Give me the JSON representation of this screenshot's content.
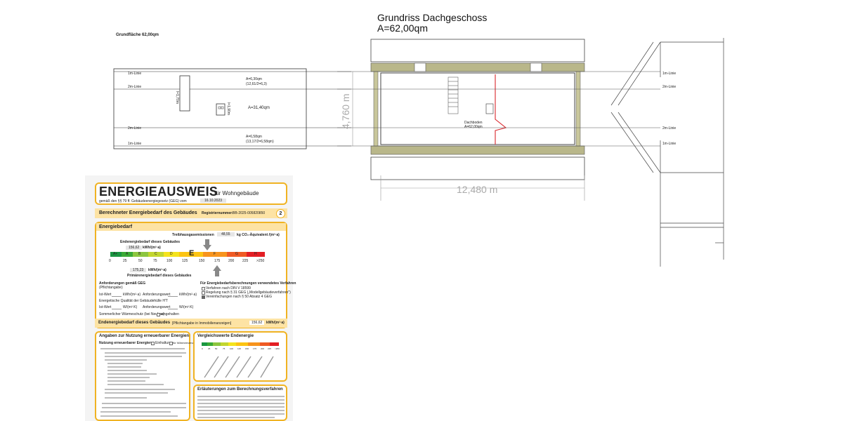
{
  "plan_title": "Grundriss Dachgeschoss",
  "plan_area": "A=62,00qm",
  "left_plan": {
    "area_label": "Grundfläche 62,00qm",
    "line_labels": [
      "1m-Linie",
      "2m-Linie",
      "2m-Linie",
      "1m-Linie"
    ],
    "zone_top": [
      "A=6,30qm",
      "(12,61/2=6,3)"
    ],
    "zone_mid": "A=31,40qm",
    "zone_bot": [
      "A=6,58qm",
      "(13,17/2=6,58qm)"
    ],
    "dim_vertical_1": "l=1,70m",
    "dim_vertical_2": "l=1,90m"
  },
  "main_plan": {
    "height_dim": "4,760 m",
    "width_dim": "12,480 m",
    "room_label": "Dachboden",
    "room_area": "A=62,00qm"
  },
  "right_plan": {
    "line_labels": [
      "1m-Linie",
      "2m-Linie",
      "2m-Linie",
      "1m-Linie"
    ]
  },
  "energy": {
    "title": "ENERGIEAUSWEIS",
    "title_suffix": "für Wohngebäude",
    "subtitle": "gemäß den §§ 79 ff. Gebäudeenergiegesetz (GEG) vom",
    "date": "16.10.2023",
    "section_header": "Berechneter Energiebedarf des Gebäudes",
    "reg_label": "Registriernummer:",
    "reg_number": "BB-2025-005820850",
    "page_number": "2",
    "energy_title": "Energiebedarf",
    "ghg_label": "Treibhausgasemissionen",
    "ghg_value": "48,55",
    "ghg_unit": "kg CO₂-Äquivalent /(m²·a)",
    "end_label": "Endenergiebedarf dieses Gebäudes",
    "end_value": "156,62",
    "end_unit": "kWh/(m²·a)",
    "classes": [
      "A+",
      "A",
      "B",
      "C",
      "D",
      "E",
      "F",
      "G",
      "H"
    ],
    "class_colors": [
      "#1a9641",
      "#3aaa35",
      "#8cc63f",
      "#c2d62f",
      "#f4e31c",
      "#fcc412",
      "#f7941d",
      "#ef5a24",
      "#e31e24"
    ],
    "current_class": "E",
    "ticks": [
      "0",
      "25",
      "50",
      "75",
      "100",
      "125",
      "150",
      "175",
      "200",
      "225",
      ">250"
    ],
    "primary_value": "175,23",
    "primary_unit": "kWh/(m²·a)",
    "primary_label": "Primärenergiebedarf dieses Gebäudes",
    "req_title": "Anforderungen gemäß GEG",
    "req_sub": "(Pflichtangabe)",
    "ist_wert": "Ist-Wert",
    "anforderungswert": "Anforderungswert",
    "unit_kwh": "kWh/(m²·a)",
    "unit_wm2k": "W/(m²·K)",
    "qual_label": "Energetische Qualität der Gebäudehülle H'T",
    "summer_label": "Sommerlicher Wärmeschutz (bei Neubau)",
    "eingehalten": "eingehalten",
    "proc_title": "Für Energiebedarfsberechnungen verwendetes Verfahren",
    "proc_items": [
      "Verfahren nach DIN V 18599",
      "Regelung nach § 31 GEG („Modellgebäudeverfahren\")",
      "Vereinfachungen nach § 50 Absatz 4 GEG"
    ],
    "footer_label": "Endenergiebedarf dieses Gebäudes",
    "footer_note": "[Pflichtangabe in Immobilienanzeigen]",
    "footer_value": "156,62",
    "footer_unit": "kWh/(m²·a)",
    "renew_title": "Angaben zur Nutzung erneuerbarer Energien",
    "renew_sub": "Nutzung erneuerbarer Energien",
    "renew_opt1": "Einhaltung",
    "renew_opt2": "für Wärmeerzeugung",
    "compare_title": "Vergleichswerte Endenergie",
    "compare_ticks": [
      "0",
      "25",
      "50",
      "75",
      "100",
      "125",
      "150",
      "175",
      "200",
      "225",
      ">250"
    ],
    "explain_title": "Erläuterungen zum Berechnungsverfahren"
  }
}
